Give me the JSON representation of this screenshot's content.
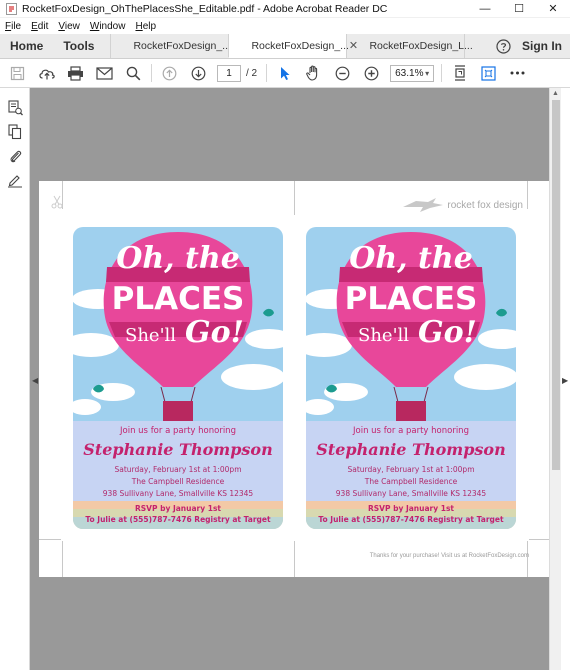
{
  "window": {
    "title": "RocketFoxDesign_OhThePlacesShe_Editable.pdf - Adobe Acrobat Reader DC",
    "minimize": "—",
    "maximize": "☐",
    "close": "✕"
  },
  "menu": {
    "items": [
      "File",
      "Edit",
      "View",
      "Window",
      "Help"
    ],
    "mnemonics": [
      "F",
      "E",
      "V",
      "W",
      "H"
    ],
    "rest": [
      "ile",
      "dit",
      "iew",
      "indow",
      "elp"
    ]
  },
  "tabs": {
    "home": "Home",
    "tools": "Tools",
    "documents": [
      {
        "label": "RocketFoxDesign_...",
        "active": false
      },
      {
        "label": "RocketFoxDesign_...",
        "active": true,
        "close": "✕"
      },
      {
        "label": "RocketFoxDesign_L...",
        "active": false
      }
    ],
    "sign_in": "Sign In"
  },
  "toolbar": {
    "page_current": "1",
    "page_total": "/ 2",
    "zoom": "63.1%",
    "zoom_caret": "▾"
  },
  "document": {
    "logo_text": "rocket fox design",
    "footer": "Thanks for your purchase!  Visit us at RocketFoxDesign.com",
    "cards": [
      {
        "heading_oh": "Oh, the",
        "heading_places": "PLACES",
        "heading_shell": "She'll",
        "heading_go": "Go!",
        "join": "Join us for a party honoring",
        "name": "Stephanie Thompson",
        "date": "Saturday, February 1st at 1:00pm",
        "venue": "The Campbell Residence",
        "address": "938 Sullivany Lane, Smallville KS 12345",
        "rsvp": "RSVP by January 1st",
        "contact": "To Julie at (555)787-7476 Registry at Target"
      },
      {
        "heading_oh": "Oh, the",
        "heading_places": "PLACES",
        "heading_shell": "She'll",
        "heading_go": "Go!",
        "join": "Join us for a party honoring",
        "name": "Stephanie Thompson",
        "date": "Saturday, February 1st at 1:00pm",
        "venue": "The Campbell Residence",
        "address": "938 Sullivany Lane, Smallville KS 12345",
        "rsvp": "RSVP by January 1st",
        "contact": "To Julie at (555)787-7476 Registry at Target"
      }
    ]
  },
  "colors": {
    "accent_blue": "#1473e6",
    "pink_dark": "#c4226d",
    "balloon_pink": "#e8479a",
    "sky": "#9fd0ee",
    "doc_bg": "#999999"
  }
}
